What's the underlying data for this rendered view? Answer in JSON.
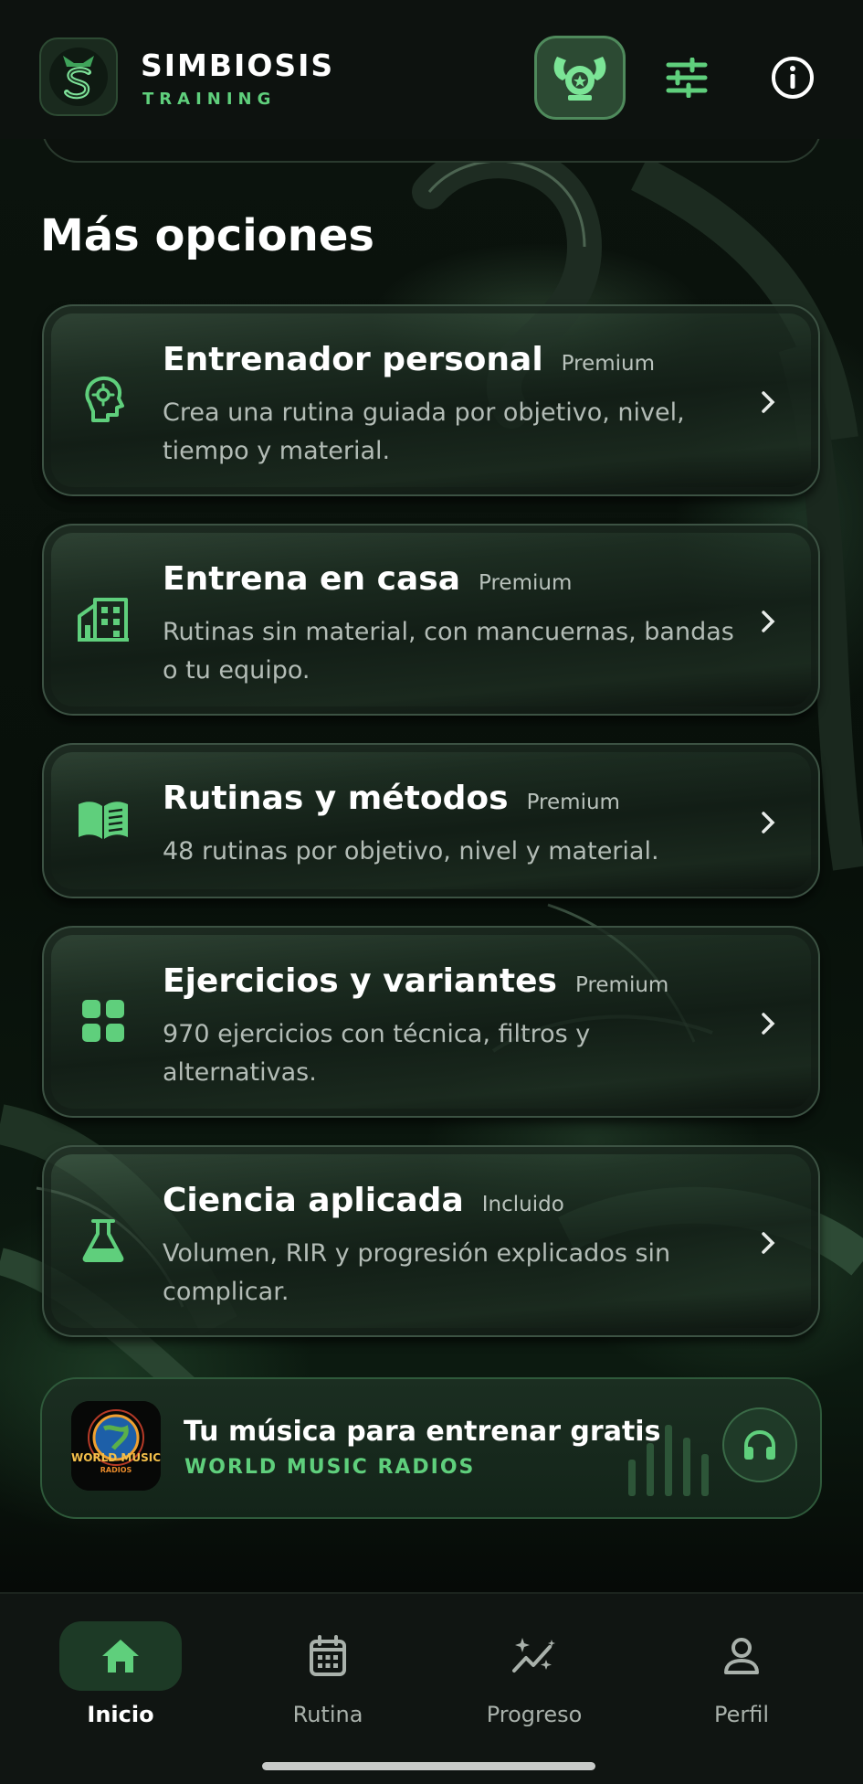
{
  "header": {
    "brand_name": "SIMBIOSIS",
    "brand_subtitle": "TRAINING",
    "icons": [
      "logo-icon",
      "trainer-icon",
      "filters-icon",
      "info-icon"
    ]
  },
  "section": {
    "title": "Más opciones"
  },
  "options": [
    {
      "title": "Entrenador personal",
      "badge": "Premium",
      "description": "Crea una rutina guiada por objetivo, nivel, tiempo y material.",
      "icon": "brain-icon"
    },
    {
      "title": "Entrena en casa",
      "badge": "Premium",
      "description": "Rutinas sin material, con mancuernas, bandas o tu equipo.",
      "icon": "building-icon"
    },
    {
      "title": "Rutinas y métodos",
      "badge": "Premium",
      "description": "48 rutinas por objetivo, nivel y material.",
      "icon": "book-icon"
    },
    {
      "title": "Ejercicios y variantes",
      "badge": "Premium",
      "description": "970 ejercicios con técnica, filtros y alternativas.",
      "icon": "grid-icon"
    },
    {
      "title": "Ciencia aplicada",
      "badge": "Incluido",
      "description": "Volumen, RIR y progresión explicados sin complicar.",
      "icon": "flask-icon"
    }
  ],
  "music": {
    "title": "Tu música para entrenar gratis",
    "subtitle": "WORLD MUSIC RADIOS",
    "logo_text_top": "WORLD MUSIC",
    "logo_text_bottom": "RADIOS"
  },
  "nav": {
    "items": [
      {
        "label": "Inicio",
        "icon": "home-icon",
        "active": true
      },
      {
        "label": "Rutina",
        "icon": "calendar-icon",
        "active": false
      },
      {
        "label": "Progreso",
        "icon": "sparkle-chart-icon",
        "active": false
      },
      {
        "label": "Perfil",
        "icon": "user-icon",
        "active": false
      }
    ]
  },
  "colors": {
    "accent": "#5fcf7c",
    "background": "#060a07",
    "header": "#0d120f",
    "card_border": "#3c5243"
  }
}
